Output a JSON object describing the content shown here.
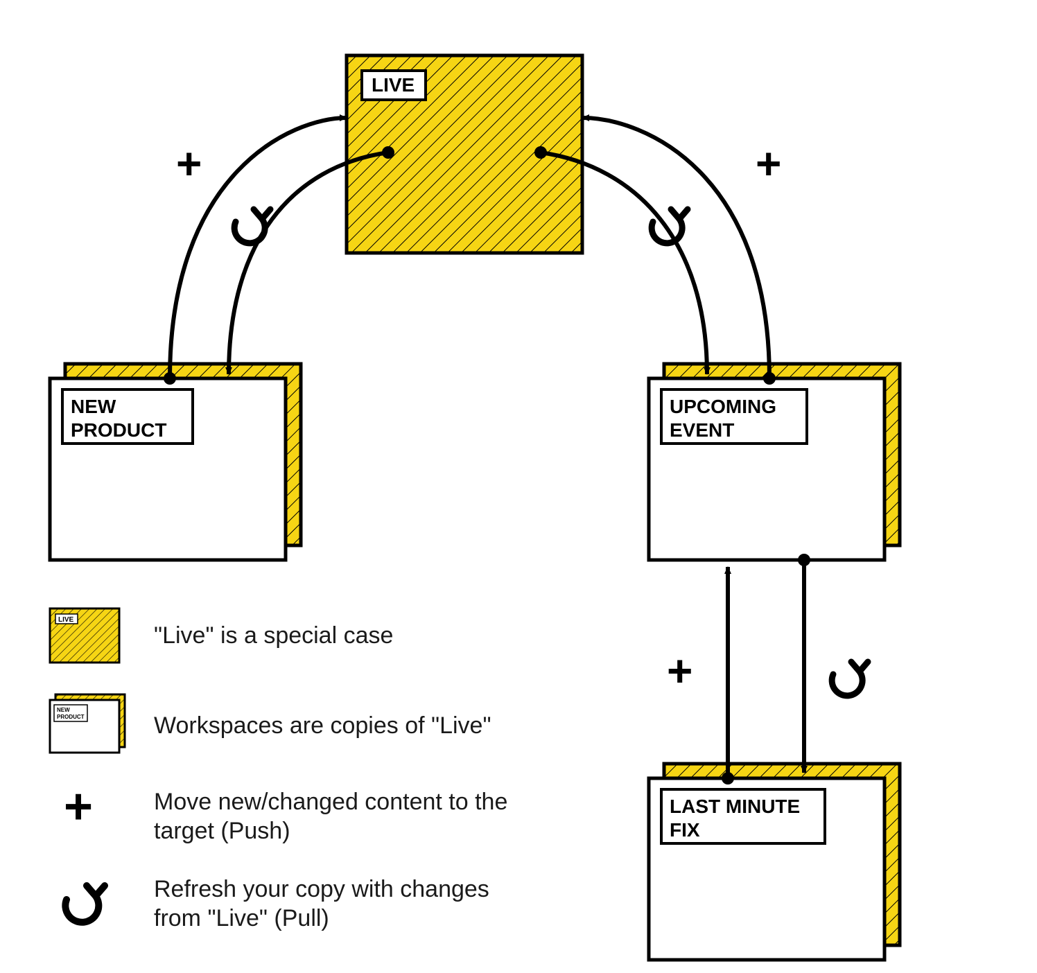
{
  "colors": {
    "yellow": "#F6D514",
    "black": "#000000",
    "text": "#1a1a1a"
  },
  "nodes": {
    "live": {
      "label": "LIVE"
    },
    "new_product": {
      "label_l1": "NEW",
      "label_l2": "PRODUCT"
    },
    "upcoming_event": {
      "label_l1": "UPCOMING",
      "label_l2": "EVENT"
    },
    "last_minute_fix": {
      "label_l1": "LAST MINUTE",
      "label_l2": "FIX"
    }
  },
  "legend": {
    "live_mini_label": "LIVE",
    "workspace_mini_l1": "NEW",
    "workspace_mini_l2": "PRODUCT",
    "item1": "\"Live\" is a special case",
    "item2": "Workspaces are copies of \"Live\"",
    "item3_l1": "Move new/changed content to the",
    "item3_l2": "target (Push)",
    "item4_l1": "Refresh your copy with changes",
    "item4_l2": "from \"Live\" (Pull)"
  },
  "icons": {
    "plus": "+",
    "refresh": "refresh-icon"
  }
}
